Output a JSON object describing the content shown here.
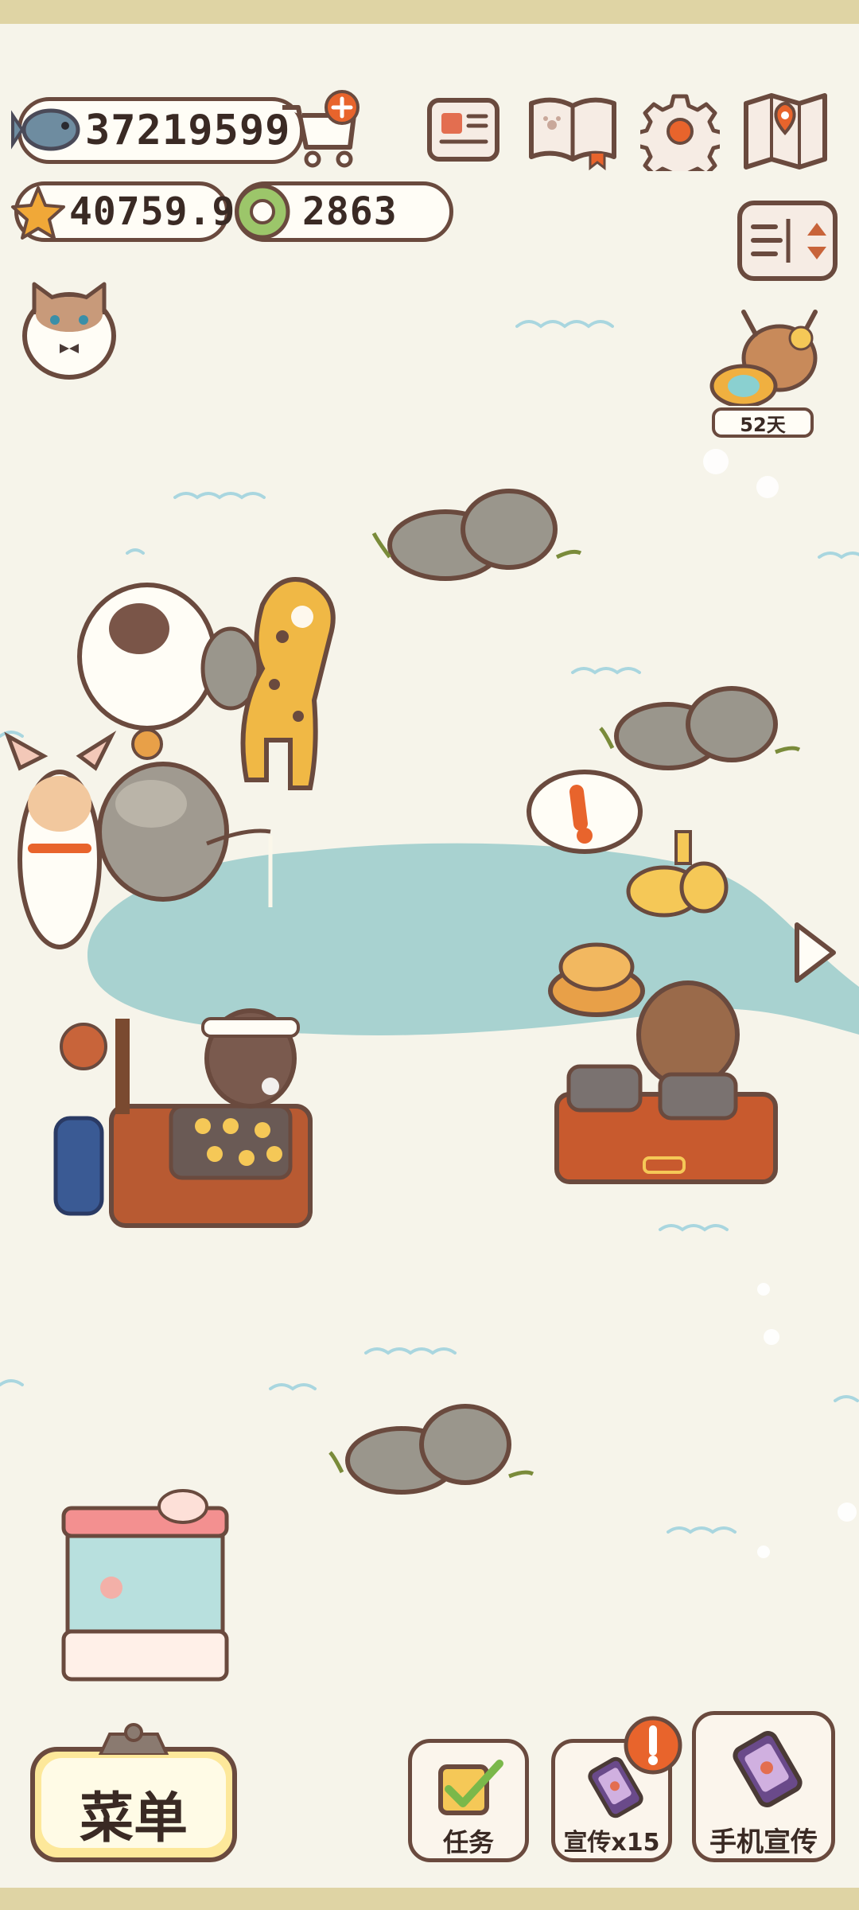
{
  "hud": {
    "fish_count": "37219599",
    "star_count": "40759.9",
    "ring_count": "2863"
  },
  "event": {
    "days_left": "52天"
  },
  "bottom_bar": {
    "menu_label": "菜单",
    "task_label": "任务",
    "promote_label": "宣传x15",
    "phone_promote_label": "手机宣传"
  },
  "icons": {
    "fish": "fish-icon",
    "shop": "shop-cart-icon",
    "star": "star-icon",
    "ring": "donut-ring-icon",
    "news": "newspaper-icon",
    "book": "paw-book-icon",
    "settings": "gear-icon",
    "map": "map-icon",
    "layout": "layout-toggle-icon",
    "next": "chevron-right-icon",
    "alert": "exclamation-icon"
  },
  "colors": {
    "background": "#f6f4ea",
    "outline": "#6a4a3e",
    "water": "#a8d2d0",
    "accent": "#e8642c",
    "menu_yellow": "#fde89a"
  }
}
